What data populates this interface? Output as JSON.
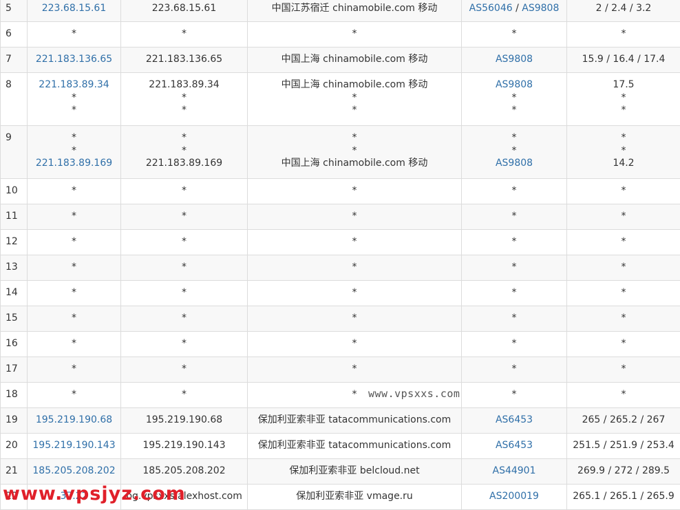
{
  "rows": [
    {
      "hop": "5",
      "ip": [
        "223.68.15.61"
      ],
      "host": [
        "223.68.15.61"
      ],
      "loc": [
        "中国江苏宿迁 chinamobile.com 移动"
      ],
      "as": [
        [
          "AS56046",
          "AS9808"
        ]
      ],
      "rtt": [
        "2 / 2.4 / 3.2"
      ]
    },
    {
      "hop": "6",
      "ip": [
        "*"
      ],
      "host": [
        "*"
      ],
      "loc": [
        "*"
      ],
      "as": [
        [
          "*"
        ]
      ],
      "rtt": [
        "*"
      ]
    },
    {
      "hop": "7",
      "ip": [
        "221.183.136.65"
      ],
      "host": [
        "221.183.136.65"
      ],
      "loc": [
        "中国上海 chinamobile.com 移动"
      ],
      "as": [
        [
          "AS9808"
        ]
      ],
      "rtt": [
        "15.9 / 16.4 / 17.4"
      ]
    },
    {
      "hop": "8",
      "ip": [
        "221.183.89.34",
        "*",
        "*"
      ],
      "host": [
        "221.183.89.34",
        "*",
        "*"
      ],
      "loc": [
        "中国上海 chinamobile.com 移动",
        "*",
        "*"
      ],
      "as": [
        [
          "AS9808"
        ],
        [
          "*"
        ],
        [
          "*"
        ]
      ],
      "rtt": [
        "17.5",
        "*",
        "*"
      ]
    },
    {
      "hop": "9",
      "ip": [
        "*",
        "*",
        "221.183.89.169"
      ],
      "host": [
        "*",
        "*",
        "221.183.89.169"
      ],
      "loc": [
        "*",
        "*",
        "中国上海 chinamobile.com 移动"
      ],
      "as": [
        [
          "*"
        ],
        [
          "*"
        ],
        [
          "AS9808"
        ]
      ],
      "rtt": [
        "*",
        "*",
        "14.2"
      ]
    },
    {
      "hop": "10",
      "ip": [
        "*"
      ],
      "host": [
        "*"
      ],
      "loc": [
        "*"
      ],
      "as": [
        [
          "*"
        ]
      ],
      "rtt": [
        "*"
      ]
    },
    {
      "hop": "11",
      "ip": [
        "*"
      ],
      "host": [
        "*"
      ],
      "loc": [
        "*"
      ],
      "as": [
        [
          "*"
        ]
      ],
      "rtt": [
        "*"
      ]
    },
    {
      "hop": "12",
      "ip": [
        "*"
      ],
      "host": [
        "*"
      ],
      "loc": [
        "*"
      ],
      "as": [
        [
          "*"
        ]
      ],
      "rtt": [
        "*"
      ]
    },
    {
      "hop": "13",
      "ip": [
        "*"
      ],
      "host": [
        "*"
      ],
      "loc": [
        "*"
      ],
      "as": [
        [
          "*"
        ]
      ],
      "rtt": [
        "*"
      ]
    },
    {
      "hop": "14",
      "ip": [
        "*"
      ],
      "host": [
        "*"
      ],
      "loc": [
        "*"
      ],
      "as": [
        [
          "*"
        ]
      ],
      "rtt": [
        "*"
      ]
    },
    {
      "hop": "15",
      "ip": [
        "*"
      ],
      "host": [
        "*"
      ],
      "loc": [
        "*"
      ],
      "as": [
        [
          "*"
        ]
      ],
      "rtt": [
        "*"
      ]
    },
    {
      "hop": "16",
      "ip": [
        "*"
      ],
      "host": [
        "*"
      ],
      "loc": [
        "*"
      ],
      "as": [
        [
          "*"
        ]
      ],
      "rtt": [
        "*"
      ]
    },
    {
      "hop": "17",
      "ip": [
        "*"
      ],
      "host": [
        "*"
      ],
      "loc": [
        "*"
      ],
      "as": [
        [
          "*"
        ]
      ],
      "rtt": [
        "*"
      ]
    },
    {
      "hop": "18",
      "ip": [
        "*"
      ],
      "host": [
        "*"
      ],
      "loc": [
        "*"
      ],
      "as": [
        [
          "*"
        ]
      ],
      "rtt": [
        "*"
      ]
    },
    {
      "hop": "19",
      "ip": [
        "195.219.190.68"
      ],
      "host": [
        "195.219.190.68"
      ],
      "loc": [
        "保加利亚索非亚 tatacommunications.com"
      ],
      "as": [
        [
          "AS6453"
        ]
      ],
      "rtt": [
        "265 / 265.2 / 267"
      ]
    },
    {
      "hop": "20",
      "ip": [
        "195.219.190.143"
      ],
      "host": [
        "195.219.190.143"
      ],
      "loc": [
        "保加利亚索非亚 tatacommunications.com"
      ],
      "as": [
        [
          "AS6453"
        ]
      ],
      "rtt": [
        "251.5 / 251.9 / 253.4"
      ]
    },
    {
      "hop": "21",
      "ip": [
        "185.205.208.202"
      ],
      "host": [
        "185.205.208.202"
      ],
      "loc": [
        "保加利亚索非亚 belcloud.net"
      ],
      "as": [
        [
          "AS44901"
        ]
      ],
      "rtt": [
        "269.9 / 272 / 289.5"
      ]
    },
    {
      "hop": "22",
      "ip": [
        "37.22"
      ],
      "host": [
        "bg.vpsxxs.alexhost.com"
      ],
      "loc": [
        "保加利亚索非亚 vmage.ru"
      ],
      "as": [
        [
          "AS200019"
        ]
      ],
      "rtt": [
        "265.1 / 265.1 / 265.9"
      ]
    }
  ],
  "watermarks": {
    "vpsxxs": "www.vpsxxs.com",
    "vpsjyz": "www.vpsjyz.com"
  },
  "colors": {
    "link": "#2f6fa8",
    "row_alt": "#f8f8f8",
    "border": "#dcdcdc",
    "watermark_red": "#e0202a"
  }
}
